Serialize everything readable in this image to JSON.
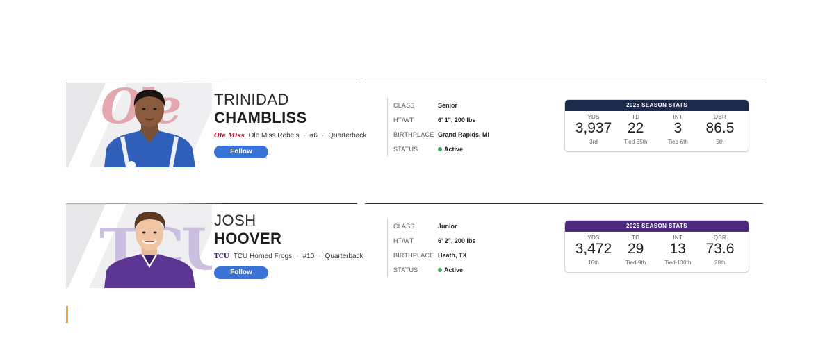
{
  "colors": {
    "follow": "#3a73d8",
    "status_active": "#3aa156",
    "accent_line": "#f0a23a"
  },
  "players": [
    {
      "first_name": "TRINIDAD",
      "last_name": "CHAMBLISS",
      "team_logo": "Ole Miss",
      "team": "Ole Miss Rebels",
      "number": "#6",
      "position": "Quarterback",
      "follow_label": "Follow",
      "header_color": "#1b2a4a",
      "rule_color": "#e8897a",
      "bio": [
        {
          "label": "CLASS",
          "value": "Senior"
        },
        {
          "label": "HT/WT",
          "value": "6' 1\", 200 lbs"
        },
        {
          "label": "BIRTHPLACE",
          "value": "Grand Rapids, MI"
        },
        {
          "label": "STATUS",
          "value": "Active"
        }
      ],
      "stats_title": "2025 SEASON STATS",
      "stats": [
        {
          "label": "YDS",
          "value": "3,937",
          "rank": "3rd"
        },
        {
          "label": "TD",
          "value": "22",
          "rank": "Tied-35th"
        },
        {
          "label": "INT",
          "value": "3",
          "rank": "Tied-6th"
        },
        {
          "label": "QBR",
          "value": "86.5",
          "rank": "5th"
        }
      ]
    },
    {
      "first_name": "JOSH",
      "last_name": "HOOVER",
      "team_logo": "TCU",
      "team": "TCU Horned Frogs",
      "number": "#10",
      "position": "Quarterback",
      "follow_label": "Follow",
      "header_color": "#4d2a7f",
      "rule_color": "#e8897a",
      "bio": [
        {
          "label": "CLASS",
          "value": "Junior"
        },
        {
          "label": "HT/WT",
          "value": "6' 2\", 200 lbs"
        },
        {
          "label": "BIRTHPLACE",
          "value": "Heath, TX"
        },
        {
          "label": "STATUS",
          "value": "Active"
        }
      ],
      "stats_title": "2025 SEASON STATS",
      "stats": [
        {
          "label": "YDS",
          "value": "3,472",
          "rank": "16th"
        },
        {
          "label": "TD",
          "value": "29",
          "rank": "Tied-9th"
        },
        {
          "label": "INT",
          "value": "13",
          "rank": "Tied-130th"
        },
        {
          "label": "QBR",
          "value": "73.6",
          "rank": "28th"
        }
      ]
    }
  ]
}
